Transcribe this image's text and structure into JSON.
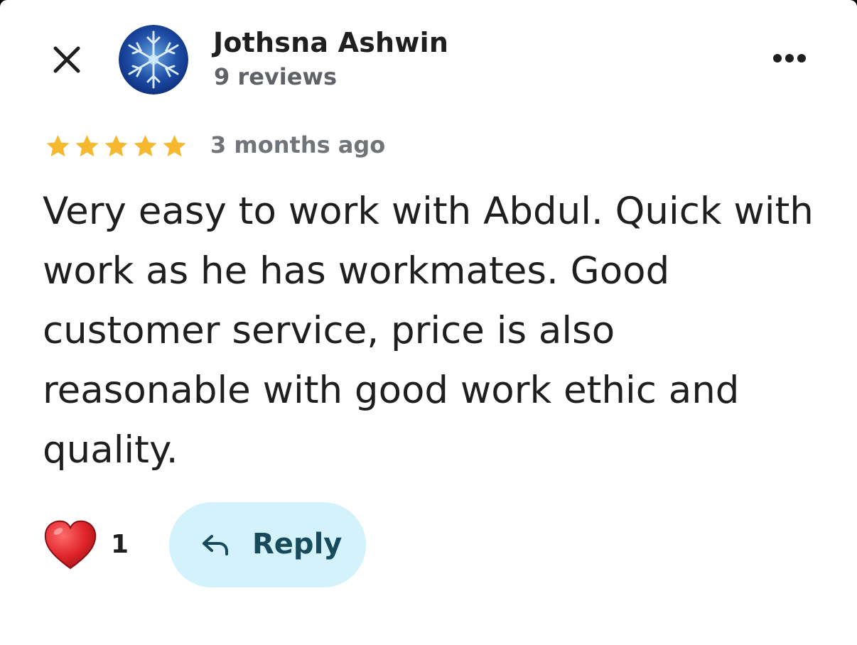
{
  "review": {
    "author_name": "Jothsna Ashwin",
    "review_count": "9 reviews",
    "rating": 5,
    "rating_max": 5,
    "time_ago": "3 months ago",
    "text": "Very easy to work with Abdul. Quick with work as he has workmates. Good customer service, price is also reasonable with good work ethic and quality."
  },
  "actions": {
    "like_count": "1",
    "reply_label": "Reply"
  },
  "icons": {
    "close": "close-icon",
    "avatar": "snowflake-avatar",
    "more": "more-horizontal-icon",
    "star": "star-icon",
    "heart": "heart-icon",
    "reply": "reply-arrow-icon"
  },
  "colors": {
    "star": "#f5b82e",
    "reply_bg": "#d3f2fb",
    "reply_text": "#174a5a",
    "heart": "#e0262b",
    "text_primary": "#1f1f1f",
    "text_secondary": "#5f6368"
  }
}
